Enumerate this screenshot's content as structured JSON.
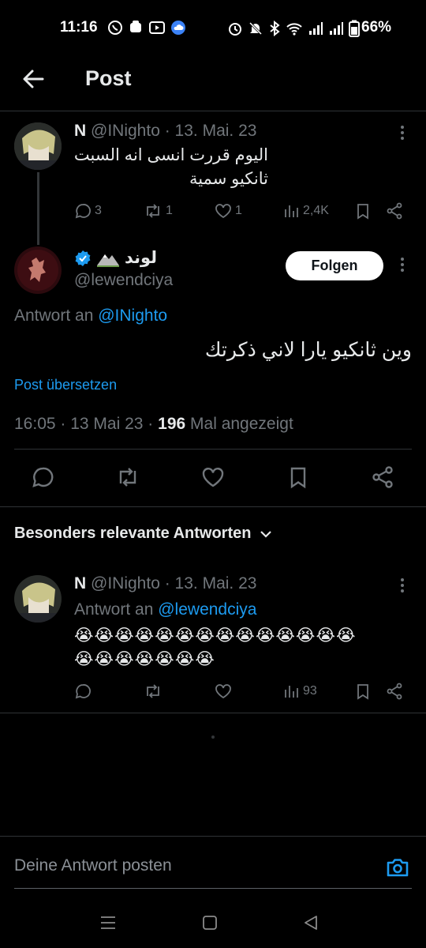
{
  "status_bar": {
    "time": "11:16",
    "battery": "66%"
  },
  "header": {
    "title": "Post"
  },
  "parent_tweet": {
    "display_name": "N",
    "handle": "@INighto",
    "date": "· 13. Mai. 23",
    "text_line1": "اليوم قررت انسى انه السبت",
    "text_line2": "ثانكيو سمية",
    "replies": "3",
    "retweets": "1",
    "likes": "1",
    "views": "2,4K"
  },
  "main_tweet": {
    "display_name": "لوند",
    "handle": "@lewendciya",
    "follow_label": "Folgen",
    "reply_to_prefix": "Antwort an",
    "reply_to_handle": "@INighto",
    "text": "وين ثانكيو يارا لاني ذكرتك",
    "translate_label": "Post übersetzen",
    "time": "16:05",
    "date": "· 13 Mai 23 ·",
    "view_count": "196",
    "view_suffix": "Mal angezeigt"
  },
  "replies_section": {
    "sort_label": "Besonders relevante Antworten"
  },
  "reply_tweet": {
    "display_name": "N",
    "handle": "@INighto",
    "date": "· 13. Mai. 23",
    "reply_to_prefix": "Antwort an",
    "reply_to_handle": "@lewendciya",
    "emoji_line1": "😭😭😭😭😭😭😭😭😭😭😭😭😭😭",
    "emoji_line2": "😭😭😭😭😭😭😭",
    "views": "93"
  },
  "composer": {
    "placeholder": "Deine Antwort posten"
  },
  "colors": {
    "background": "#000000",
    "accent": "#1d9bf0",
    "muted": "#71767b",
    "divider": "#2f3336"
  },
  "icons": [
    "whatsapp-icon",
    "gallery-icon",
    "youtube-icon",
    "cloud-icon",
    "alarm-icon",
    "mute-icon",
    "bluetooth-icon",
    "wifi-icon",
    "signal-icon",
    "battery-icon",
    "back-arrow-icon",
    "more-icon",
    "reply-icon",
    "retweet-icon",
    "like-icon",
    "views-icon",
    "bookmark-icon",
    "share-icon",
    "verified-icon",
    "chevron-down-icon",
    "camera-icon",
    "menu-nav-icon",
    "home-nav-icon",
    "back-nav-icon"
  ]
}
